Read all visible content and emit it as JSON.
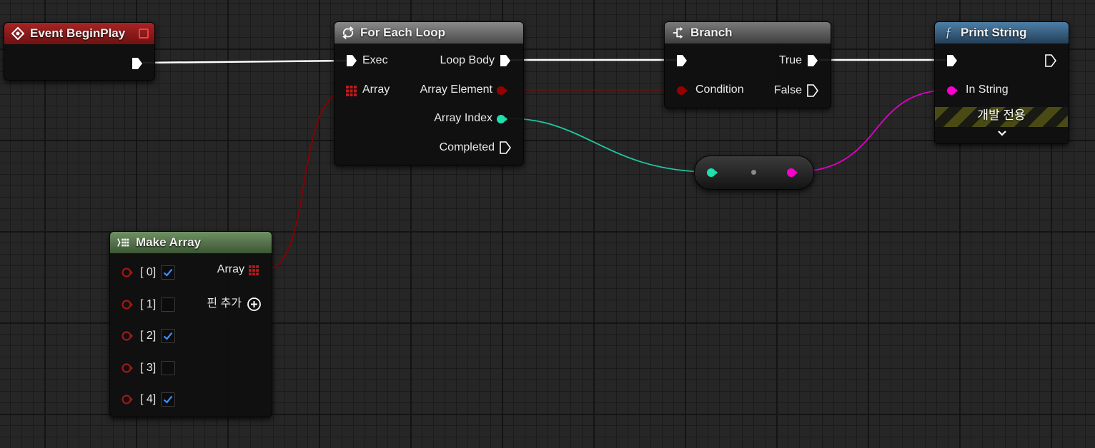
{
  "nodes": {
    "event_begin_play": {
      "title": "Event BeginPlay"
    },
    "for_each_loop": {
      "title": "For Each Loop",
      "pins": {
        "exec": "Exec",
        "array": "Array",
        "loop_body": "Loop Body",
        "array_element": "Array Element",
        "array_index": "Array Index",
        "completed": "Completed"
      }
    },
    "branch": {
      "title": "Branch",
      "pins": {
        "condition": "Condition",
        "true": "True",
        "false": "False"
      }
    },
    "print_string": {
      "title": "Print String",
      "pins": {
        "in_string": "In String"
      },
      "dev_only": "개발 전용"
    },
    "make_array": {
      "title": "Make Array",
      "output": "Array",
      "add_pin": "핀 추가",
      "items": [
        {
          "label": "[ 0]",
          "checked": true
        },
        {
          "label": "[ 1]",
          "checked": false
        },
        {
          "label": "[ 2]",
          "checked": true
        },
        {
          "label": "[ 3]",
          "checked": false
        },
        {
          "label": "[ 4]",
          "checked": true
        }
      ]
    }
  },
  "colors": {
    "event_header": "#8c1c1c",
    "loop_header": "#7a7a7a",
    "branch_header": "#6a6a6a",
    "function_header": "#3d6a8e",
    "array_header": "#5e7e52",
    "exec": "#ffffff",
    "bool": "#950000",
    "int": "#1fe0ac",
    "string": "#f900d0"
  }
}
